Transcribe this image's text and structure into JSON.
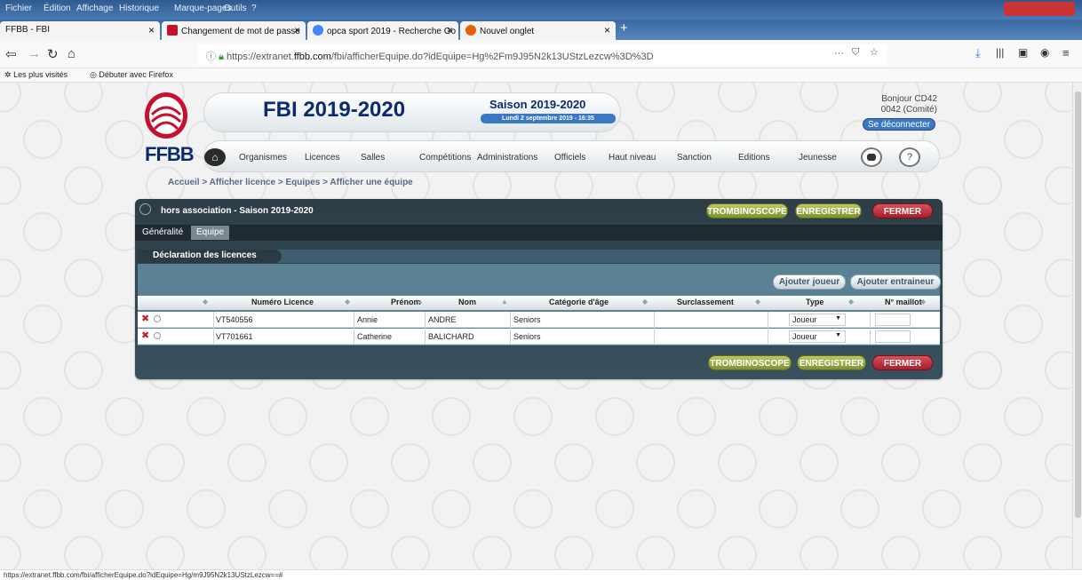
{
  "browser": {
    "menu": [
      "Fichier",
      "Édition",
      "Affichage",
      "Historique",
      "Marque-pages",
      "Outils",
      "?"
    ],
    "tabs": [
      {
        "label": "FFBB - FBI",
        "close": "×"
      },
      {
        "label": "Changement de mot de passe",
        "close": "×"
      },
      {
        "label": "opca sport 2019 - Recherche Go",
        "close": "×"
      },
      {
        "label": "Nouvel onglet",
        "close": "×"
      }
    ],
    "new_tab": "+",
    "url_prefix": "https://extranet.",
    "url_host": "ffbb.com",
    "url_path": "/fbi/afficherEquipe.do?idEquipe=Hg%2Fm9J95N2k13UStzLezcw%3D%3D",
    "url_actions": "···",
    "bookmarks": [
      "Les plus visités",
      "Débuter avec Firefox"
    ],
    "status_url": "https://extranet.ffbb.com/fbi/afficherEquipe.do?idEquipe=Hg/m9J95N2k13UStzLezcw==#"
  },
  "header": {
    "logo_text": "FFBB",
    "title": "FBI 2019-2020",
    "saison": "Saison 2019-2020",
    "date": "Lundi 2 septembre 2019 - 16:35",
    "greeting_line1": "Bonjour CD42",
    "greeting_line2": "0042 (Comité)",
    "logout": "Se déconnecter"
  },
  "nav": [
    "Organismes",
    "Licences",
    "Salles",
    "Compétitions",
    "Administrations",
    "Officiels",
    "Haut niveau",
    "Sanction",
    "Editions",
    "Jeunesse"
  ],
  "help": "?",
  "breadcrumb": "Accueil > Afficher licence > Equipes > Afficher une équipe",
  "panel": {
    "title": "hors association - Saison 2019-2020",
    "btn_trombi": "TROMBINOSCOPE",
    "btn_save": "ENREGISTRER",
    "btn_close": "FERMER",
    "tabs": [
      "Généralité",
      "Equipe"
    ],
    "section": "Déclaration des licences",
    "add_player": "Ajouter joueur",
    "add_coach": "Ajouter entraineur"
  },
  "table": {
    "columns": [
      "Numéro Licence",
      "Prénom",
      "Nom",
      "Catégorie d'âge",
      "Surclassement",
      "Type",
      "N° maillot"
    ],
    "rows": [
      {
        "licence": "VT540556",
        "prenom": "Annie",
        "nom": "ANDRE",
        "categorie": "Seniors",
        "surclassement": "",
        "type": "Joueur",
        "maillot": ""
      },
      {
        "licence": "VT701661",
        "prenom": "Catherine",
        "nom": "BALICHARD",
        "categorie": "Seniors",
        "surclassement": "",
        "type": "Joueur",
        "maillot": ""
      }
    ]
  },
  "colors": {
    "brand_red": "#c5102e",
    "brand_navy": "#0a2c6e",
    "panel": "#2d3d46",
    "btn_green": "#8fa23d",
    "btn_red": "#b8303c"
  }
}
